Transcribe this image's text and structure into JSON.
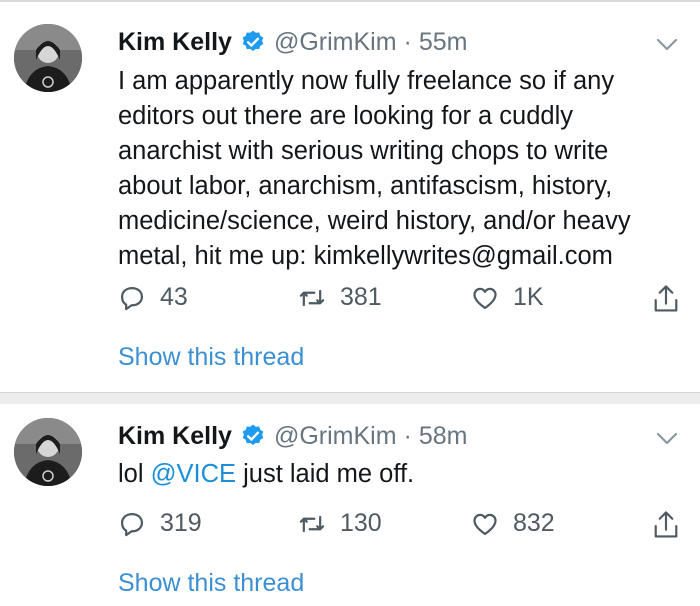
{
  "tweets": [
    {
      "author_name": "Kim Kelly",
      "handle": "@GrimKim",
      "separator": "·",
      "time": "55m",
      "text": "I am apparently now fully freelance so if any editors out there are looking for a cuddly anarchist with serious writing chops to write about labor, anarchism, antifascism, history, medicine/science, weird history, and/or heavy metal, hit me up: kimkellywrites@gmail.com",
      "replies": "43",
      "retweets": "381",
      "likes": "1K",
      "show_thread": "Show this thread"
    },
    {
      "author_name": "Kim Kelly",
      "handle": "@GrimKim",
      "separator": "·",
      "time": "58m",
      "text_before": "lol ",
      "mention": "@VICE",
      "text_after": " just laid me off.",
      "replies": "319",
      "retweets": "130",
      "likes": "832",
      "show_thread": "Show this thread"
    }
  ],
  "colors": {
    "link": "#3b8fd3",
    "verified": "#1d9bf0",
    "secondary_text": "#687580"
  },
  "icons": [
    "verified-badge-icon",
    "chevron-down-icon",
    "reply-icon",
    "retweet-icon",
    "like-icon",
    "share-icon"
  ]
}
